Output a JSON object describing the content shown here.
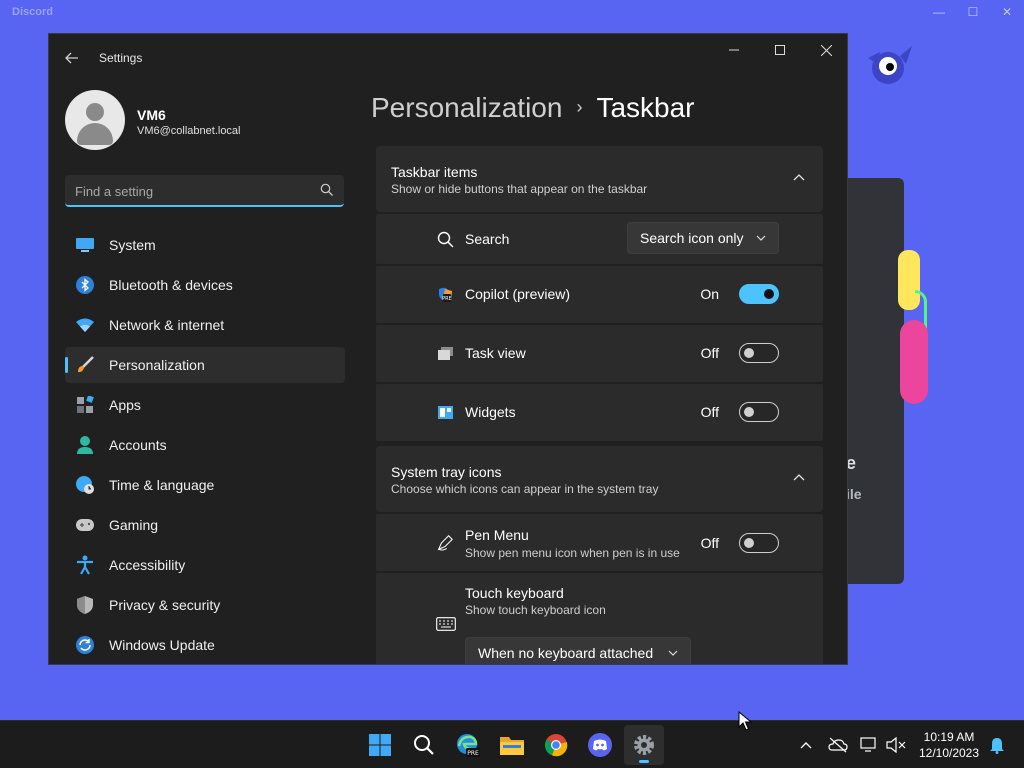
{
  "discord": {
    "title": "Discord",
    "controls": [
      "—",
      "☐",
      "✕"
    ],
    "card_text_1": "e",
    "card_text_2": "ile"
  },
  "window": {
    "title": "Settings",
    "controls": {
      "minimize": "—",
      "maximize": "☐",
      "close": "✕"
    }
  },
  "profile": {
    "name": "VM6",
    "email": "VM6@collabnet.local"
  },
  "search": {
    "placeholder": "Find a setting",
    "value": ""
  },
  "sidebar": {
    "items": [
      {
        "label": "System",
        "icon": "system-icon",
        "selected": false
      },
      {
        "label": "Bluetooth & devices",
        "icon": "bluetooth-icon",
        "selected": false
      },
      {
        "label": "Network & internet",
        "icon": "wifi-icon",
        "selected": false
      },
      {
        "label": "Personalization",
        "icon": "brush-icon",
        "selected": true
      },
      {
        "label": "Apps",
        "icon": "apps-icon",
        "selected": false
      },
      {
        "label": "Accounts",
        "icon": "person-icon",
        "selected": false
      },
      {
        "label": "Time & language",
        "icon": "globe-clock-icon",
        "selected": false
      },
      {
        "label": "Gaming",
        "icon": "gamepad-icon",
        "selected": false
      },
      {
        "label": "Accessibility",
        "icon": "accessibility-icon",
        "selected": false
      },
      {
        "label": "Privacy & security",
        "icon": "shield-icon",
        "selected": false
      },
      {
        "label": "Windows Update",
        "icon": "update-icon",
        "selected": false
      }
    ]
  },
  "breadcrumb": {
    "parent": "Personalization",
    "separator": "›",
    "current": "Taskbar"
  },
  "taskbar_items": {
    "title": "Taskbar items",
    "subtitle": "Show or hide buttons that appear on the taskbar",
    "search": {
      "label": "Search",
      "value": "Search icon only"
    },
    "copilot": {
      "label": "Copilot (preview)",
      "state": "On"
    },
    "task_view": {
      "label": "Task view",
      "state": "Off"
    },
    "widgets": {
      "label": "Widgets",
      "state": "Off"
    }
  },
  "system_tray": {
    "title": "System tray icons",
    "subtitle": "Choose which icons can appear in the system tray",
    "pen_menu": {
      "label": "Pen Menu",
      "sub": "Show pen menu icon when pen is in use",
      "state": "Off"
    },
    "touch_keyboard": {
      "label": "Touch keyboard",
      "sub": "Show touch keyboard icon",
      "value": "When no keyboard attached"
    }
  },
  "clock": {
    "time": "10:19 AM",
    "date": "12/10/2023"
  },
  "colors": {
    "accent": "#4cc2ff",
    "window_bg": "#202020",
    "card_bg": "#2b2b2b",
    "desktop": "#5865f2"
  }
}
